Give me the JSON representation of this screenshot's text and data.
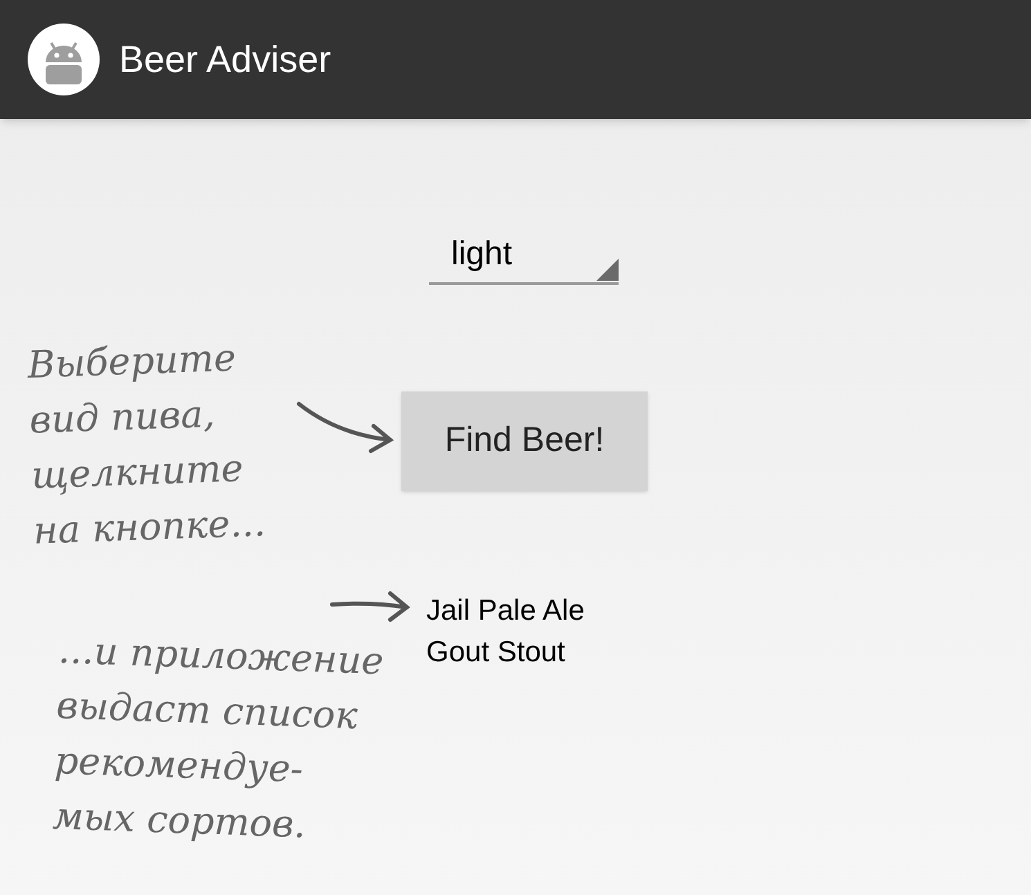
{
  "app_bar": {
    "title": "Beer Adviser"
  },
  "spinner": {
    "value": "light"
  },
  "find_button": {
    "label": "Find Beer!"
  },
  "results": [
    "Jail Pale Ale",
    "Gout Stout"
  ],
  "annotations": [
    {
      "lines": [
        "Выберите",
        "вид пива,",
        "щелкните",
        "на кнопке..."
      ]
    },
    {
      "lines": [
        "...и приложение",
        "выдаст список",
        "рекомендуе-",
        "мых сортов."
      ]
    }
  ]
}
